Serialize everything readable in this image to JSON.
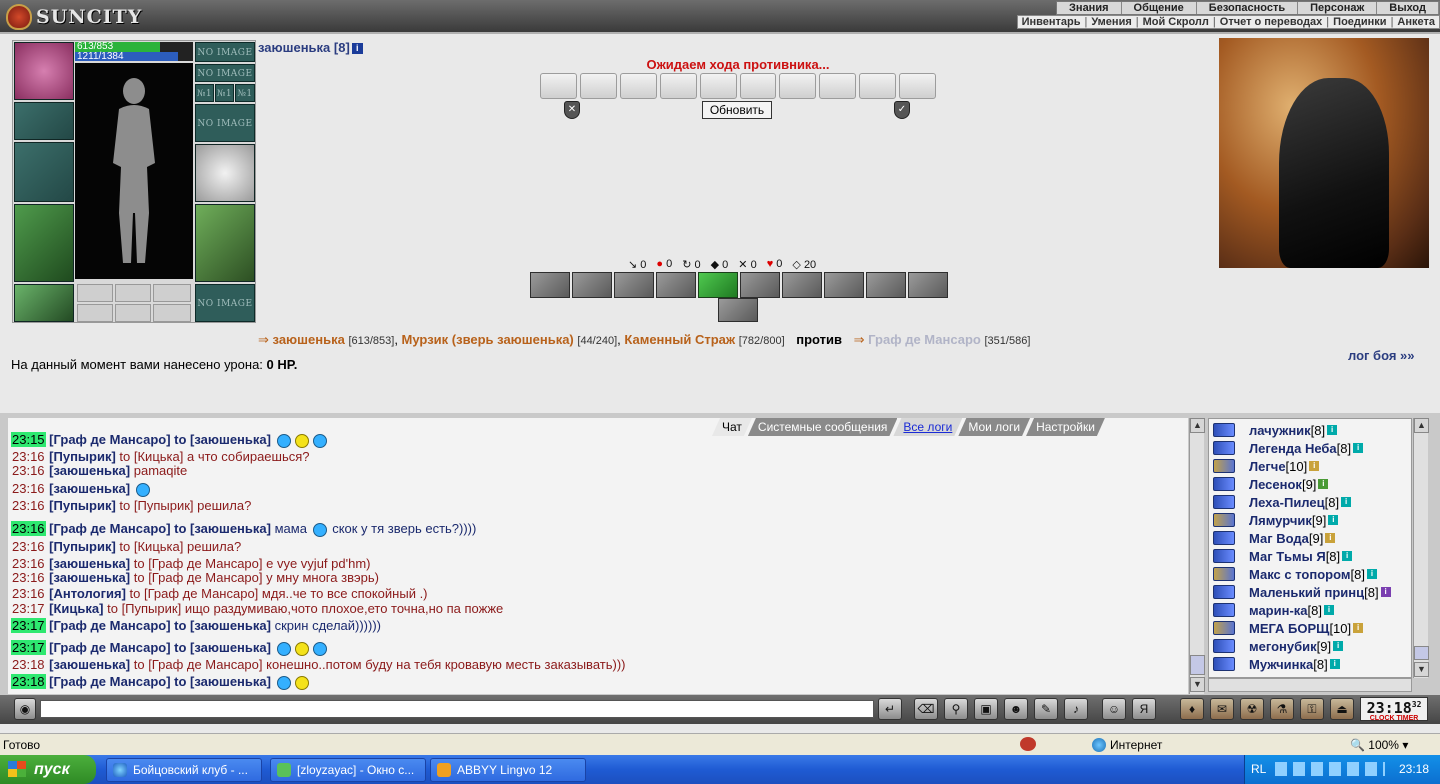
{
  "app": {
    "logo": "SUNCITY"
  },
  "menu_top": [
    "Знания",
    "Общение",
    "Безопасность",
    "Персонаж",
    "Выход"
  ],
  "menu_sub": [
    "Инвентарь",
    "Умения",
    "Мой Скролл",
    "Отчет о переводах",
    "Поединки",
    "Анкета"
  ],
  "character": {
    "hp": "613/853",
    "hp_fraction": 0.72,
    "mp": "1211/1384",
    "mp_fraction": 0.87,
    "no_image_label": "NO IMAGE",
    "slot_short": "№1"
  },
  "opponent": {
    "name": "заюшенька [8]"
  },
  "battle": {
    "waiting": "Ожидаем хода противника...",
    "refresh": "Обновить",
    "stats": [
      {
        "icon": "arrow-icon",
        "value": "0"
      },
      {
        "icon": "blood-drop-icon",
        "value": "0"
      },
      {
        "icon": "counter-icon",
        "value": "0"
      },
      {
        "icon": "block-icon",
        "value": "0"
      },
      {
        "icon": "cross-icon",
        "value": "0"
      },
      {
        "icon": "heart-icon",
        "value": "0"
      },
      {
        "icon": "shield-stat-icon",
        "value": "20"
      }
    ],
    "arrow_glyph": "⇒"
  },
  "teams": {
    "me": {
      "name": "заюшенька",
      "hp": "[613/853]"
    },
    "pet": {
      "name": "Мурзик (зверь заюшенька)",
      "hp": "[44/240]"
    },
    "guard": {
      "name": "Каменный Страж",
      "hp": "[782/800]"
    },
    "versus": "против",
    "enemy": {
      "name": "Граф де Мансаро",
      "hp": "[351/586]"
    }
  },
  "damage": {
    "prefix": "На данный момент вами нанесено урона:",
    "value": "0 HP."
  },
  "battle_log_link": "лог боя »»",
  "chat_tabs": [
    "Чат",
    "Системные сообщения",
    "Все логи",
    "Мои логи",
    "Настройки"
  ],
  "chat": [
    {
      "time": "23:15",
      "hl": true,
      "nick": "[Граф де Мансаро]",
      "to": "to [заюшенька]",
      "priv": true,
      "text": "",
      "smiles": 3
    },
    {
      "time": "23:16",
      "hl": false,
      "nick": "[Пупырик]",
      "to": "to [Кицька]",
      "priv": false,
      "text": "а что собираешься?",
      "smiles": 0
    },
    {
      "time": "23:16",
      "hl": false,
      "nick": "[заюшенька]",
      "to": "",
      "priv": false,
      "text": "pamaqite",
      "smiles": 0
    },
    {
      "time": "23:16",
      "hl": false,
      "nick": "[заюшенька]",
      "to": "",
      "priv": false,
      "text": "",
      "smiles": 1
    },
    {
      "time": "23:16",
      "hl": false,
      "nick": "[Пупырик]",
      "to": "to [Пупырик]",
      "priv": false,
      "text": "решила?",
      "smiles": 0
    },
    {
      "time": "23:16",
      "hl": true,
      "nick": "[Граф де Мансаро]",
      "to": "to [заюшенька]",
      "priv": true,
      "text": "мама",
      "text2": "скок у тя зверь есть?))))",
      "smiles": 1
    },
    {
      "time": "23:16",
      "hl": false,
      "nick": "[Пупырик]",
      "to": "to [Кицька]",
      "priv": false,
      "text": "решила?",
      "smiles": 0
    },
    {
      "time": "23:16",
      "hl": false,
      "nick": "[заюшенька]",
      "to": "to [Граф де Мансаро]",
      "priv": false,
      "text": "e vye vyjuf pd'hm)",
      "smiles": 0
    },
    {
      "time": "23:16",
      "hl": false,
      "nick": "[заюшенька]",
      "to": "to [Граф де Мансаро]",
      "priv": false,
      "text": "у мну многа звэрь)",
      "smiles": 0
    },
    {
      "time": "23:16",
      "hl": false,
      "nick": "[Антология]",
      "to": "to [Граф де Мансаро]",
      "priv": false,
      "text": "мдя..че то все спокойный .)",
      "smiles": 0
    },
    {
      "time": "23:17",
      "hl": false,
      "nick": "[Кицька]",
      "to": "to [Пупырик]",
      "priv": false,
      "text": "ищо раздумиваю,чото плохое,ето точна,но па пожже",
      "smiles": 0
    },
    {
      "time": "23:17",
      "hl": true,
      "nick": "[Граф де Мансаро]",
      "to": "to [заюшенька]",
      "priv": true,
      "text": "скрин сделай))))))",
      "smiles": 0
    },
    {
      "time": "23:17",
      "hl": true,
      "nick": "[Граф де Мансаро]",
      "to": "to [заюшенька]",
      "priv": true,
      "text": "",
      "smiles": 3
    },
    {
      "time": "23:18",
      "hl": false,
      "nick": "[заюшенька]",
      "to": "to [Граф де Мансаро]",
      "priv": false,
      "text": "конешно..потом буду на тебя кровавую месть заказывать)))",
      "smiles": 0
    },
    {
      "time": "23:18",
      "hl": true,
      "nick": "[Граф де Мансаро]",
      "to": "to [заюшенька]",
      "priv": true,
      "text": "",
      "smiles": 2
    }
  ],
  "online": [
    {
      "name": "лачужник",
      "lvl": "[8]",
      "badge": "b"
    },
    {
      "name": "Легенда Неба",
      "lvl": "[8]",
      "badge": "b"
    },
    {
      "name": "Легче",
      "lvl": "[10]",
      "badge": "y"
    },
    {
      "name": "Лесенок",
      "lvl": "[9]",
      "badge": "g"
    },
    {
      "name": "Леха-Пилец",
      "lvl": "[8]",
      "badge": "b"
    },
    {
      "name": "Лямурчик",
      "lvl": "[9]",
      "badge": "b"
    },
    {
      "name": "Маг Вода",
      "lvl": "[9]",
      "badge": "y"
    },
    {
      "name": "Маг Тьмы Я",
      "lvl": "[8]",
      "badge": "b"
    },
    {
      "name": "Макс с топором",
      "lvl": "[8]",
      "badge": "b"
    },
    {
      "name": "Маленький принц",
      "lvl": "[8]",
      "badge": "p"
    },
    {
      "name": "марин-ка",
      "lvl": "[8]",
      "badge": "b"
    },
    {
      "name": "МЕГА БОРЩ",
      "lvl": "[10]",
      "badge": "y"
    },
    {
      "name": "мегонубик",
      "lvl": "[9]",
      "badge": "b"
    },
    {
      "name": "Мужчинка",
      "lvl": "[8]",
      "badge": "b"
    }
  ],
  "clock": {
    "time": "23:18",
    "seconds": "32",
    "label": "CLOCK TIMER"
  },
  "statusbar": {
    "left": "Готово",
    "zone": "Интернет",
    "zoom": "100%"
  },
  "taskbar": {
    "start": "пуск",
    "tasks": [
      "Бойцовский клуб - ...",
      "[zloyzayac] - Окно с...",
      "ABBYY Lingvo 12"
    ],
    "lang": "RL",
    "time": "23:18"
  }
}
